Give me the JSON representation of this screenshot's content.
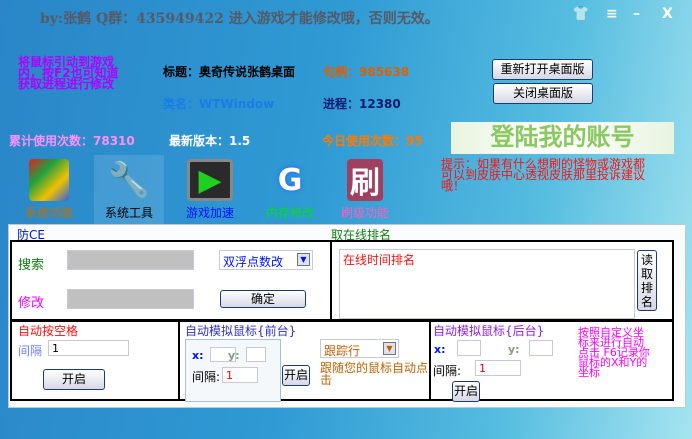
{
  "header": {
    "title": "by:张鹤   Q群：435949422    进入游戏才能修改哦，否则无效。",
    "icons": [
      "shirt-icon",
      "menu-icon",
      "minimize-icon",
      "close-icon"
    ],
    "icon_glyphs": [
      "👕",
      "≡",
      "–",
      "X"
    ]
  },
  "hint": "将鼠标引动到游戏内，按F2也可知道获取进程进行修改",
  "info": {
    "title_label": "标题：奥奇传说张鹤桌面",
    "handle_label": "句柄：985638",
    "class_label": "类名：WTWindow",
    "process_label": "进程：12380",
    "total_uses": "累计使用次数：78310",
    "latest_version": "最新版本：1.5",
    "today_uses": "今日使用次数：95"
  },
  "buttons": {
    "reopen": "重新打开桌面版",
    "close": "关闭桌面版"
  },
  "login_banner": "登陆我的账号",
  "tip": "提示：如果有什么想刷的怪物或游戏都可以到皮肤中心透视皮肤那里投诉建议哦！",
  "tabs": [
    {
      "label": "系统功能",
      "color": "#c07000"
    },
    {
      "label": "系统工具",
      "color": "#000000"
    },
    {
      "label": "游戏加速",
      "color": "#0010ff"
    },
    {
      "label": "内存修改",
      "color": "#00e020"
    },
    {
      "label": "刷级功能",
      "color": "#ff60c0"
    }
  ],
  "anti_ce": {
    "label": "防CE",
    "search_label": "搜索",
    "modify_label": "修改",
    "search_value": "",
    "modify_value": "",
    "mode": "双浮点数改",
    "confirm": "确定"
  },
  "ranking": {
    "label": "取在线排名",
    "text": "在线时间排名",
    "button": "读取排名"
  },
  "space": {
    "title": "自动按空格",
    "interval_label": "间隔",
    "interval": "1",
    "start": "开启"
  },
  "front": {
    "title": "自动模拟鼠标{前台}",
    "x_label": "x:",
    "y_label": "y:",
    "x": "",
    "y": "",
    "interval_label": "间隔:",
    "interval": "1",
    "start": "开启",
    "mode": "跟踪行",
    "note": "跟随您的鼠标自动点击"
  },
  "back": {
    "title": "自动模拟鼠标{后台}",
    "x_label": "x:",
    "y_label": "y:",
    "x": "",
    "y": "",
    "interval_label": "间隔:",
    "interval": "1",
    "start": "开启",
    "note": "按照自定义坐标来进行自动点击 F6记录你鼠标的X和Y的坐标"
  }
}
